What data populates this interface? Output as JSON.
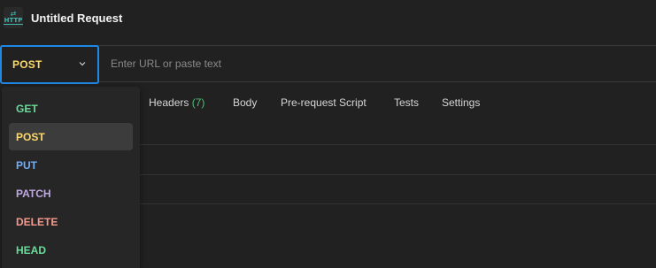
{
  "header": {
    "icon": "http-request-icon",
    "icon_text": "HTTP",
    "title": "Untitled Request"
  },
  "request": {
    "method": "POST",
    "method_color": "#ffd966",
    "url_placeholder": "Enter URL or paste text",
    "url_value": ""
  },
  "tabs": [
    {
      "label": "Headers",
      "count": "(7)"
    },
    {
      "label": "Body"
    },
    {
      "label": "Pre-request Script"
    },
    {
      "label": "Tests"
    },
    {
      "label": "Settings"
    }
  ],
  "method_dropdown": {
    "selected": "POST",
    "options": [
      {
        "label": "GET",
        "color": "#6bdd9a"
      },
      {
        "label": "POST",
        "color": "#ffd966"
      },
      {
        "label": "PUT",
        "color": "#74aef6"
      },
      {
        "label": "PATCH",
        "color": "#c0a8e1"
      },
      {
        "label": "DELETE",
        "color": "#f79a8e"
      },
      {
        "label": "HEAD",
        "color": "#6bdd9a"
      }
    ]
  },
  "colors": {
    "background": "#212121",
    "focus_border": "#1e88e5",
    "count_badge": "#4ec275"
  }
}
